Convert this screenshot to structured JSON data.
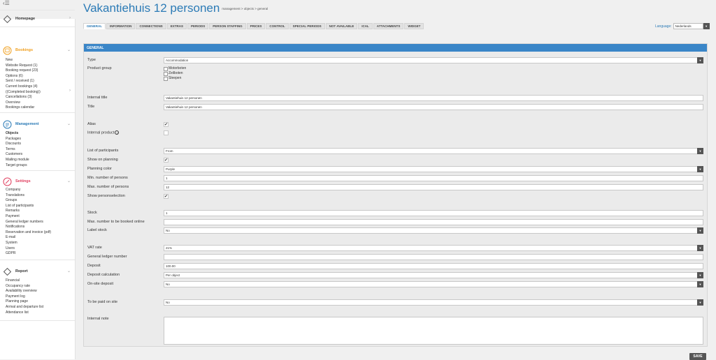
{
  "header": {
    "title": "Vakantiehuis 12 personen",
    "breadcrumb": "management > objects > general"
  },
  "tabs": [
    "GENERAL",
    "INFORMATION",
    "CONNECTIONS",
    "EXTRAS",
    "PERIODS",
    "PERSON STAFFING",
    "PRICES",
    "CONTROL",
    "SPECIAL PERIODS",
    "NOT AVAILABLE",
    "ICAL",
    "ATTACHMENTS",
    "WIDGET"
  ],
  "language": {
    "label": "Language:",
    "value": "Nederlands"
  },
  "sidebar": {
    "toggle": "‹☰",
    "homepage": "Homepage",
    "bookings": {
      "title": "Bookings",
      "items": [
        "New",
        "Website Request (1)",
        "Booking request (23)",
        "Options (6)",
        "Sent / received (1)",
        "Current bookings (4)",
        "((Completed booking))",
        "Cancellations (3)",
        "Overview",
        "Bookings calendar"
      ]
    },
    "management": {
      "title": "Management",
      "items": [
        "Objects",
        "Packages",
        "Discounts",
        "Terms",
        "Customers",
        "Mailing module",
        "Target groups"
      ]
    },
    "settings": {
      "title": "Settings",
      "items": [
        "Company",
        "Translations",
        "Groups",
        "List of participants",
        "Remarks",
        "Payment",
        "General ledger numbers",
        "Notifications",
        "Reservation and invoice (pdf)",
        "E-mail",
        "System",
        "Users",
        "GDPR"
      ]
    },
    "report": {
      "title": "Report",
      "items": [
        "Financial",
        "Occupancy rate",
        "Availability overview",
        "Payment log",
        "Planning page",
        "Arrival and departure list",
        "Attendance list"
      ]
    }
  },
  "form": {
    "section": "GENERAL",
    "type": {
      "label": "Type",
      "value": "Accommodation"
    },
    "product_group": {
      "label": "Product group",
      "options": [
        "Motorboten",
        "Zeilboten",
        "Sleepen"
      ]
    },
    "internal_title": {
      "label": "Internal title",
      "value": "Vakantiehuis 12 personen"
    },
    "title": {
      "label": "Title",
      "value": "Vakantiehuis 12 personen"
    },
    "alias": {
      "label": "Alias",
      "checked": "✔"
    },
    "internal_product": {
      "label": "Internal product",
      "info": "i"
    },
    "list_of_participants": {
      "label": "List of participants",
      "value": "From"
    },
    "show_on_planning": {
      "label": "Show on planning",
      "checked": "✔"
    },
    "planning_color": {
      "label": "Planning color",
      "value": "Purple"
    },
    "min_persons": {
      "label": "Min. number of persons",
      "value": "1"
    },
    "max_persons": {
      "label": "Max. number of persons",
      "value": "12"
    },
    "show_personselection": {
      "label": "Show personselection",
      "checked": "✔"
    },
    "stock": {
      "label": "Stock",
      "value": "1"
    },
    "max_online": {
      "label": "Max. number to be booked online",
      "value": ""
    },
    "label_stock": {
      "label": "Label stock",
      "value": "No"
    },
    "vat_rate": {
      "label": "VAT rate",
      "value": "21%"
    },
    "ledger_number": {
      "label": "General ledger number",
      "value": ""
    },
    "deposit": {
      "label": "Deposit",
      "value": "100.00"
    },
    "deposit_calc": {
      "label": "Deposit calculation",
      "value": "Per object"
    },
    "onsite_deposit": {
      "label": "On-site deposit",
      "value": "No"
    },
    "paid_on_site": {
      "label": "To be paid on site",
      "value": "No"
    },
    "internal_note": {
      "label": "Internal note",
      "value": ""
    }
  },
  "save_label": "SAVE",
  "colors": {
    "accent": "#2c7bb6",
    "panel_header": "#3a86c8",
    "bookings": "#f0a020",
    "settings": "#e04060",
    "management": "#2c7bb6"
  }
}
